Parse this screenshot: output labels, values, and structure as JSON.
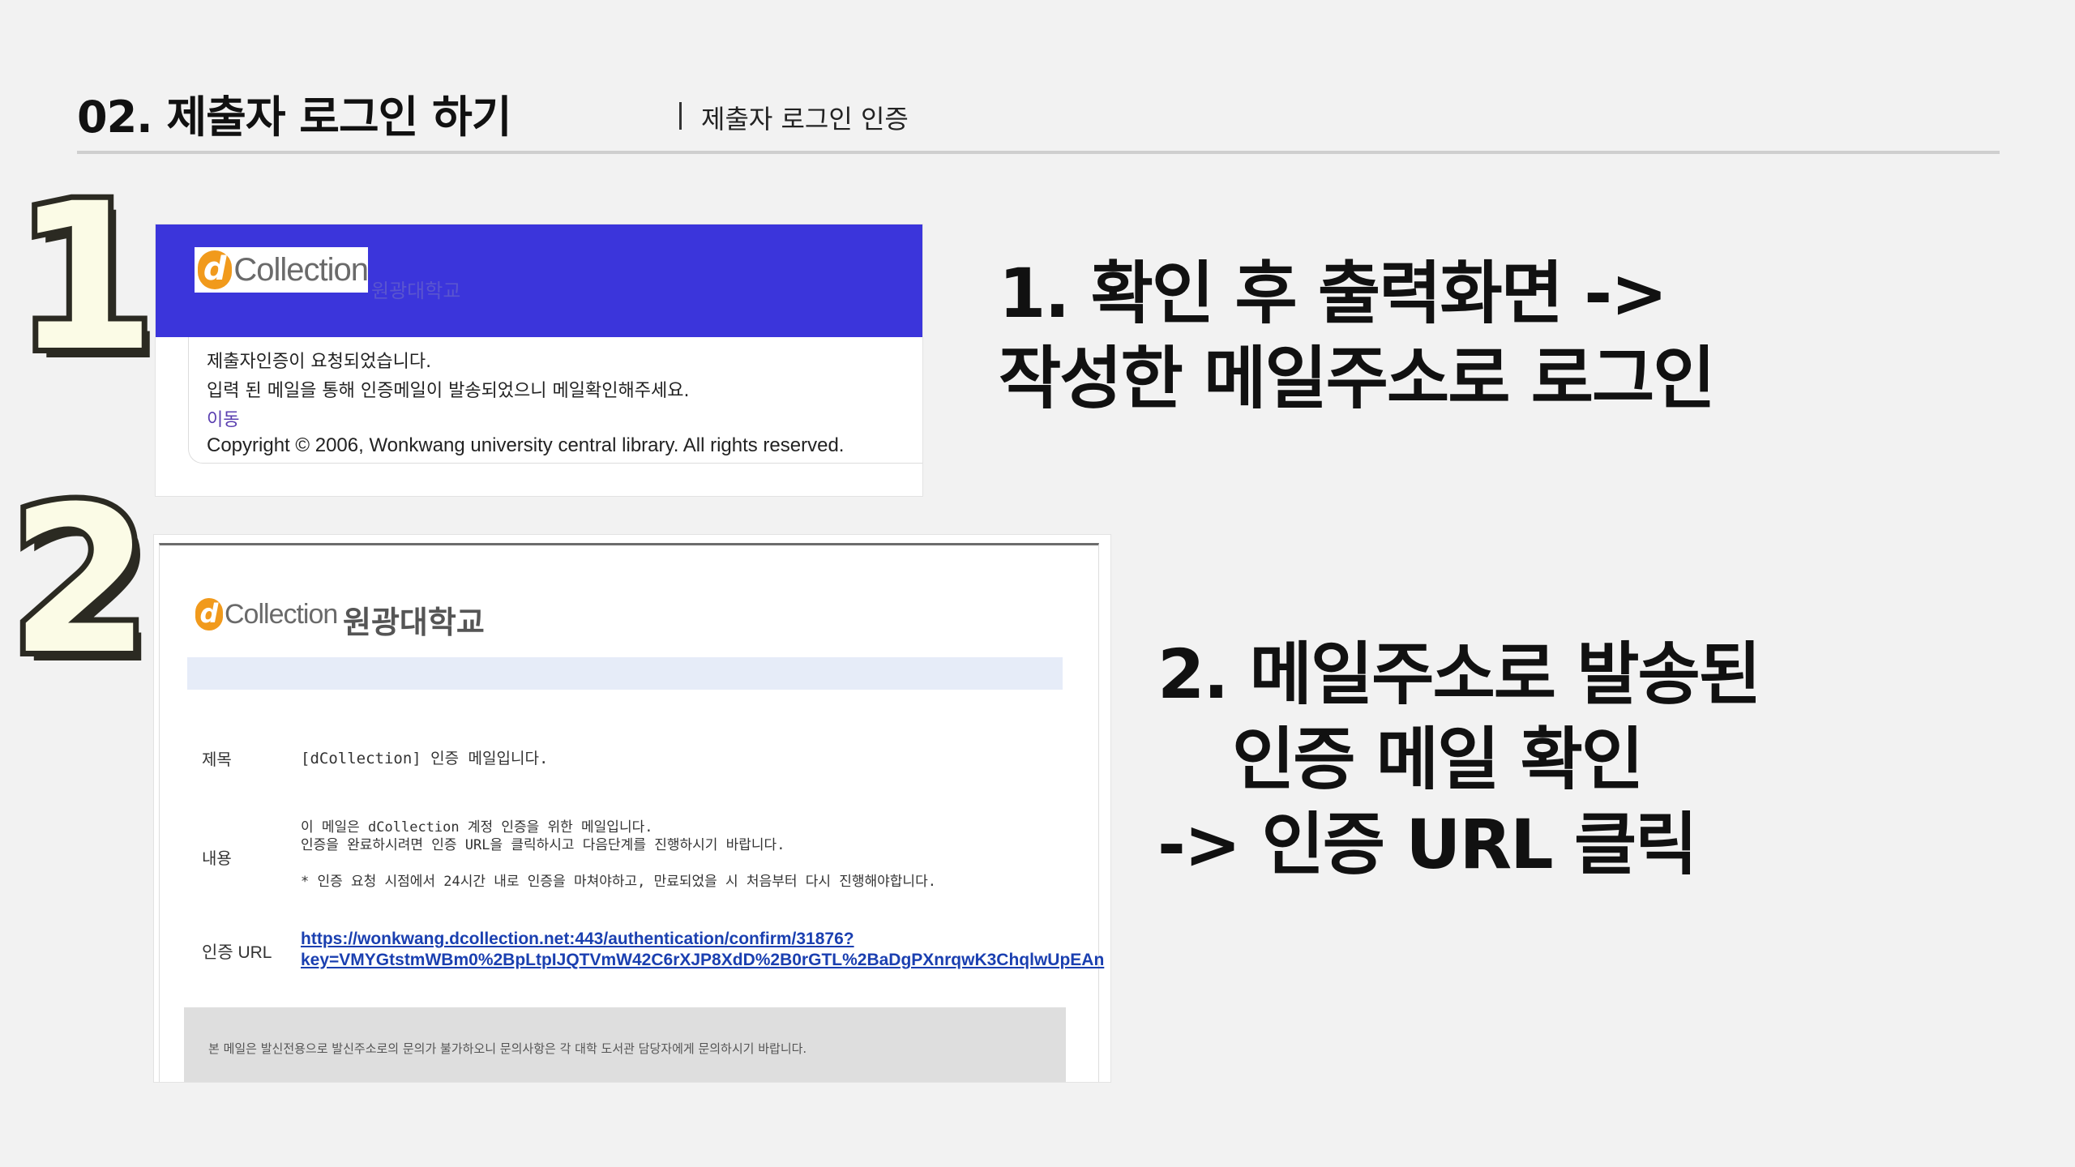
{
  "header": {
    "title": "02. 제출자 로그인 하기",
    "subtitle": "제출자 로그인 인증"
  },
  "steps": [
    {
      "badge": "1"
    },
    {
      "badge": "2"
    }
  ],
  "shot1": {
    "logo_mark": "d",
    "logo_text": "Collection",
    "university": "원광대학교",
    "message1": "제출자인증이 요청되었습니다.",
    "message2": "입력 된 메일을 통해 인증메일이 발송되었으니 메일확인해주세요.",
    "link": "이동",
    "copyright": "Copyright © 2006, Wonkwang university central library. All rights reserved."
  },
  "shot2": {
    "logo_mark": "d",
    "logo_text": "Collection",
    "university": "원광대학교",
    "subject_label": "제목",
    "subject_value": "[dCollection] 인증 메일입니다.",
    "content_label": "내용",
    "content_line1": "이 메일은 dCollection 계정 인증을 위한 메일입니다.",
    "content_line2": "인증을 완료하시려면 인증 URL을 클릭하시고 다음단계를 진행하시기 바랍니다.",
    "content_line3": "* 인증 요청 시점에서 24시간 내로 인증을 마쳐야하고, 만료되었을 시 처음부터 다시 진행해야합니다.",
    "url_label": "인증 URL",
    "url_line1": "https://wonkwang.dcollection.net:443/authentication/confirm/31876?",
    "url_line2": "key=VMYGtstmWBm0%2BpLtpIJQTVmW42C6rXJP8XdD%2B0rGTL%2BaDgPXnrqwK3ChqlwUpEAn",
    "footer": "본 메일은 발신전용으로 발신주소로의 문의가 불가하오니 문의사항은 각 대학 도서관 담당자에게 문의하시기 바랍니다."
  },
  "instructions": {
    "step1_line1": "1. 확인 후 출력화면 ->",
    "step1_line2": "작성한 메일주소로 로그인",
    "step2_line1": "2. 메일주소로 발송된",
    "step2_line2": "인증 메일 확인",
    "step2_line3": "-> 인증 URL 클릭"
  },
  "colors": {
    "background": "#f2f2f2",
    "banner_blue": "#3b35db",
    "logo_orange": "#f19a1c",
    "badge_fill": "#fbfbe6",
    "badge_outline": "#2b2a22",
    "link_blue": "#1a3fb0"
  }
}
